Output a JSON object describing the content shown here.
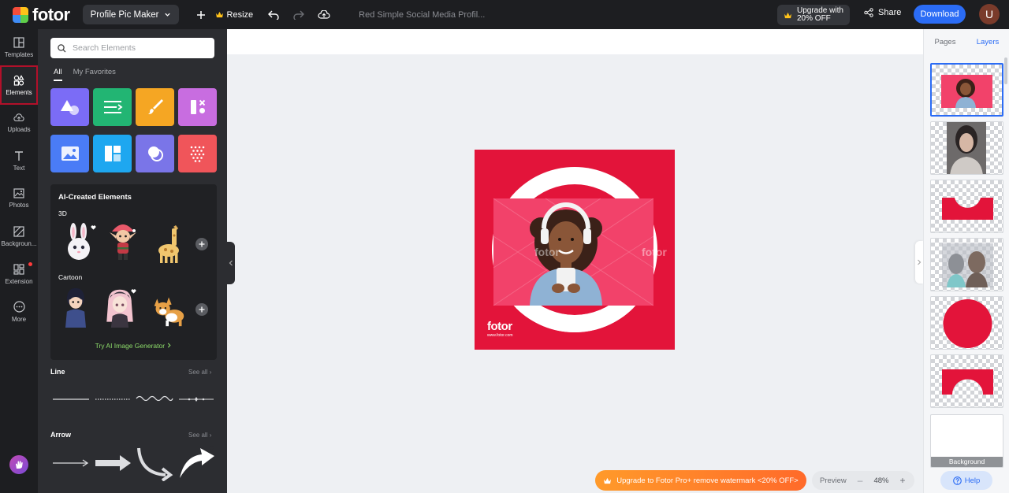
{
  "app": {
    "logo_text": "fotor"
  },
  "topbar": {
    "project_label": "Profile Pic Maker",
    "resize_label": "Resize",
    "doc_title": "Red Simple Social Media Profil...",
    "upgrade_line1": "Upgrade with",
    "upgrade_line2": "20% OFF",
    "share_label": "Share",
    "download_label": "Download",
    "avatar_initial": "U"
  },
  "rail": {
    "items": [
      {
        "label": "Templates",
        "icon": "templates-icon"
      },
      {
        "label": "Elements",
        "icon": "elements-icon"
      },
      {
        "label": "Uploads",
        "icon": "upload-cloud-icon"
      },
      {
        "label": "Text",
        "icon": "text-icon"
      },
      {
        "label": "Photos",
        "icon": "photo-icon"
      },
      {
        "label": "Backgroun...",
        "icon": "background-icon"
      },
      {
        "label": "Extension",
        "icon": "extension-icon"
      },
      {
        "label": "More",
        "icon": "more-icon"
      }
    ]
  },
  "panel": {
    "search_placeholder": "Search Elements",
    "tabs": [
      "All",
      "My Favorites"
    ],
    "tile_colors": [
      "#7b6cf6",
      "#22b573",
      "#f5a623",
      "#c86de0",
      "#4a7cf6",
      "#1ea7f0",
      "#7a75e8",
      "#f0555a"
    ],
    "ai_title": "AI-Created Elements",
    "ai_section_3d": "3D",
    "ai_section_cartoon": "Cartoon",
    "ai_link": "Try AI Image Generator",
    "line_title": "Line",
    "arrow_title": "Arrow",
    "see_all": "See all"
  },
  "canvas": {
    "brand_color": "#e3143a",
    "watermark": "fotor",
    "design_logo": "fotor",
    "design_url": "www.fotor.com"
  },
  "bottom": {
    "promo_label": "Upgrade to Fotor Pro+ remove watermark <20% OFF>",
    "preview_label": "Preview",
    "zoom_value": "48%"
  },
  "layers_panel": {
    "tabs": [
      "Pages",
      "Layers"
    ],
    "background_label": "Background",
    "help_label": "Help"
  }
}
